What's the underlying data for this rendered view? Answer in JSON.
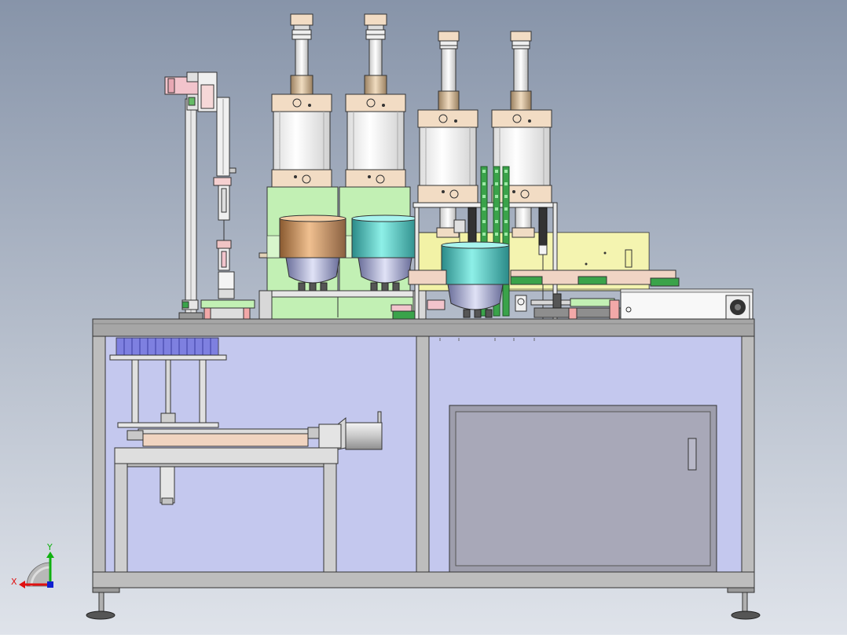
{
  "viewport": {
    "background_top": "#8794a9",
    "background_bottom": "#dfe3ea"
  },
  "triad": {
    "x_label": "X",
    "y_label": "Y",
    "x_color": "#e01010",
    "y_color": "#10b010",
    "z_color": "#1020d0"
  },
  "colors": {
    "cylinder_body": "#f4f4f4",
    "cylinder_cap": "#f2dcc4",
    "rod": "#f0f0f0",
    "collar": "#e2c9a8",
    "green_block": "#c2f0b4",
    "yellow_plate": "#f2f2a6",
    "pink_part": "#f2c4cc",
    "bowl_copper": "#d4a070",
    "bowl_teal": "#6fd0c8",
    "cup_silver": "#a8acd8",
    "frame": "#c8c8c8",
    "cabinet_panel": "#c4c8ee",
    "door": "#a4a4b4",
    "tabletop": "#a6a6a6",
    "linear_guide_green": "#3aa34a",
    "servo_motor": "#d8d8d8",
    "heater_plate": "#f0d4c0",
    "electric_box": "#f8f8f8"
  }
}
